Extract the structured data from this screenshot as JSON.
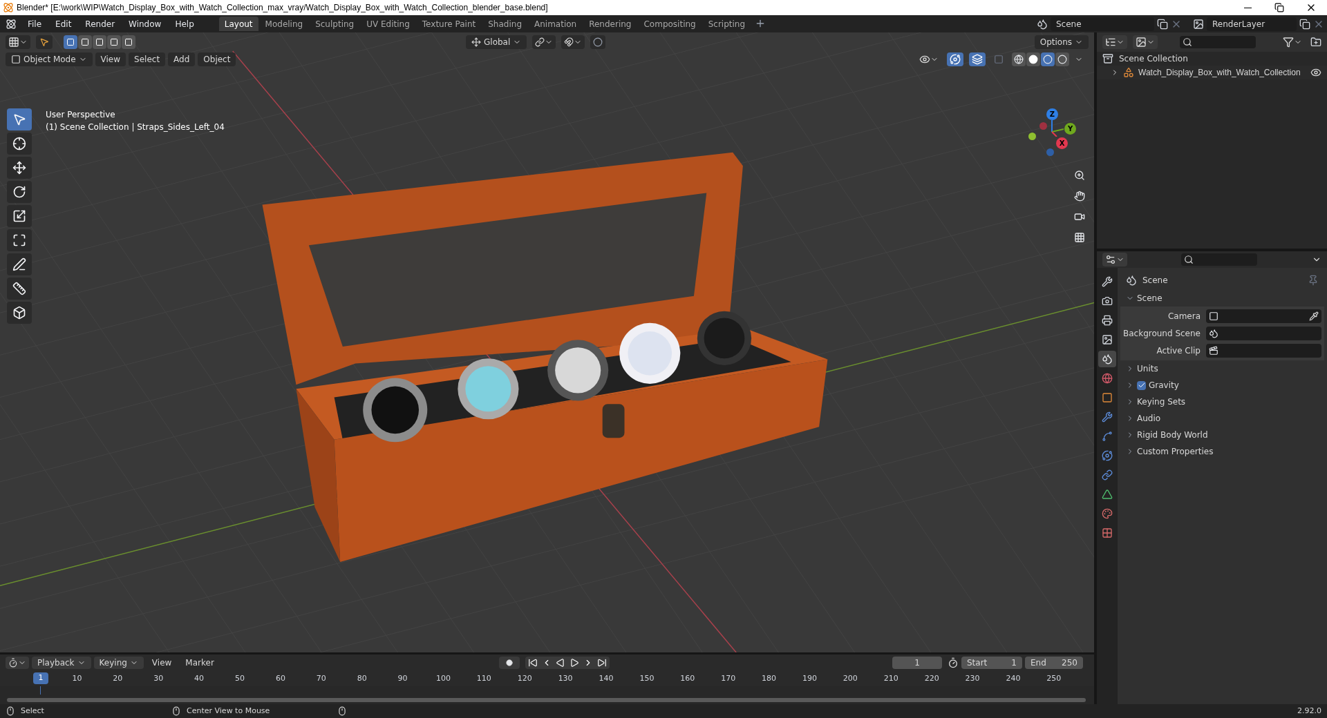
{
  "window": {
    "title": "Blender* [E:\\work\\WIP\\Watch_Display_Box_with_Watch_Collection_max_vray/Watch_Display_Box_with_Watch_Collection_blender_base.blend]"
  },
  "menu": [
    "File",
    "Edit",
    "Render",
    "Window",
    "Help"
  ],
  "workspaces": [
    {
      "label": "Layout",
      "selected": true
    },
    {
      "label": "Modeling",
      "selected": false
    },
    {
      "label": "Sculpting",
      "selected": false
    },
    {
      "label": "UV Editing",
      "selected": false
    },
    {
      "label": "Texture Paint",
      "selected": false
    },
    {
      "label": "Shading",
      "selected": false
    },
    {
      "label": "Animation",
      "selected": false
    },
    {
      "label": "Rendering",
      "selected": false
    },
    {
      "label": "Compositing",
      "selected": false
    },
    {
      "label": "Scripting",
      "selected": false
    }
  ],
  "scene_field": {
    "value": "Scene"
  },
  "view_layer_field": {
    "value": "RenderLayer"
  },
  "viewport": {
    "orientation": "Global",
    "options": "Options",
    "mode": "Object Mode",
    "menus": [
      "View",
      "Select",
      "Add",
      "Object"
    ],
    "overlay_lines": [
      "User Perspective",
      "(1) Scene Collection | Straps_Sides_Left_04"
    ],
    "select_modes": [
      {
        "selected": true
      },
      {
        "selected": false
      },
      {
        "selected": false
      },
      {
        "selected": false
      },
      {
        "selected": false
      }
    ],
    "shading": [
      {
        "kind": "wireframe",
        "selected": false
      },
      {
        "kind": "solid",
        "selected": false
      },
      {
        "kind": "material",
        "selected": true
      },
      {
        "kind": "rendered",
        "selected": false
      }
    ],
    "tools": [
      {
        "kind": "select",
        "selected": true
      },
      {
        "kind": "cursor",
        "selected": false
      },
      {
        "kind": "move",
        "selected": false
      },
      {
        "kind": "rotate",
        "selected": false
      },
      {
        "kind": "scale",
        "selected": false
      },
      {
        "kind": "transform",
        "selected": false
      },
      {
        "kind": "annotate",
        "selected": false
      },
      {
        "kind": "measure",
        "selected": false
      },
      {
        "kind": "add_cube",
        "selected": false
      }
    ],
    "gizmo_axes": [
      {
        "label": "Z",
        "color": "#2e7fe6"
      },
      {
        "label": "Y",
        "color": "#6fa81e"
      },
      {
        "label": "X",
        "color": "#e2384f"
      }
    ]
  },
  "outliner": {
    "items": [
      {
        "label": "Scene Collection",
        "children": [
          {
            "label": "Watch_Display_Box_with_Watch_Collection",
            "expanded": false,
            "visible": true
          }
        ]
      }
    ]
  },
  "properties": {
    "tabs": [
      {
        "kind": "tool",
        "selected": false
      },
      {
        "kind": "render",
        "selected": false
      },
      {
        "kind": "output",
        "selected": false
      },
      {
        "kind": "view_layer",
        "selected": false
      },
      {
        "kind": "scene",
        "selected": true
      },
      {
        "kind": "world",
        "selected": false
      },
      {
        "kind": "object",
        "selected": false
      },
      {
        "kind": "modifiers",
        "selected": false
      },
      {
        "kind": "particles",
        "selected": false
      },
      {
        "kind": "physics",
        "selected": false
      },
      {
        "kind": "constraints",
        "selected": false
      },
      {
        "kind": "data",
        "selected": false
      },
      {
        "kind": "material",
        "selected": false
      },
      {
        "kind": "texture",
        "selected": false
      }
    ],
    "context": "Scene",
    "panels": [
      {
        "title": "Scene",
        "expanded": true,
        "fields": [
          {
            "label": "Camera",
            "kind": "camera"
          },
          {
            "label": "Background Scene",
            "kind": "scene"
          },
          {
            "label": "Active Clip",
            "kind": "clip"
          }
        ]
      },
      {
        "title": "Units",
        "expanded": false
      },
      {
        "title": "Gravity",
        "expanded": false,
        "checked": true
      },
      {
        "title": "Keying Sets",
        "expanded": false
      },
      {
        "title": "Audio",
        "expanded": false
      },
      {
        "title": "Rigid Body World",
        "expanded": false
      },
      {
        "title": "Custom Properties",
        "expanded": false
      }
    ]
  },
  "timeline": {
    "menus": [
      "Playback",
      "Keying",
      "View",
      "Marker"
    ],
    "current_frame": "1",
    "playhead": "1",
    "start_label": "Start",
    "start": "1",
    "end_label": "End",
    "end": "250",
    "ticks": [
      "10",
      "20",
      "30",
      "40",
      "50",
      "60",
      "70",
      "80",
      "90",
      "100",
      "110",
      "120",
      "130",
      "140",
      "150",
      "160",
      "170",
      "180",
      "190",
      "200",
      "210",
      "220",
      "230",
      "240",
      "250"
    ]
  },
  "status_bar": {
    "items": [
      "Select",
      "Center View to Mouse"
    ],
    "version": "2.92.0"
  }
}
